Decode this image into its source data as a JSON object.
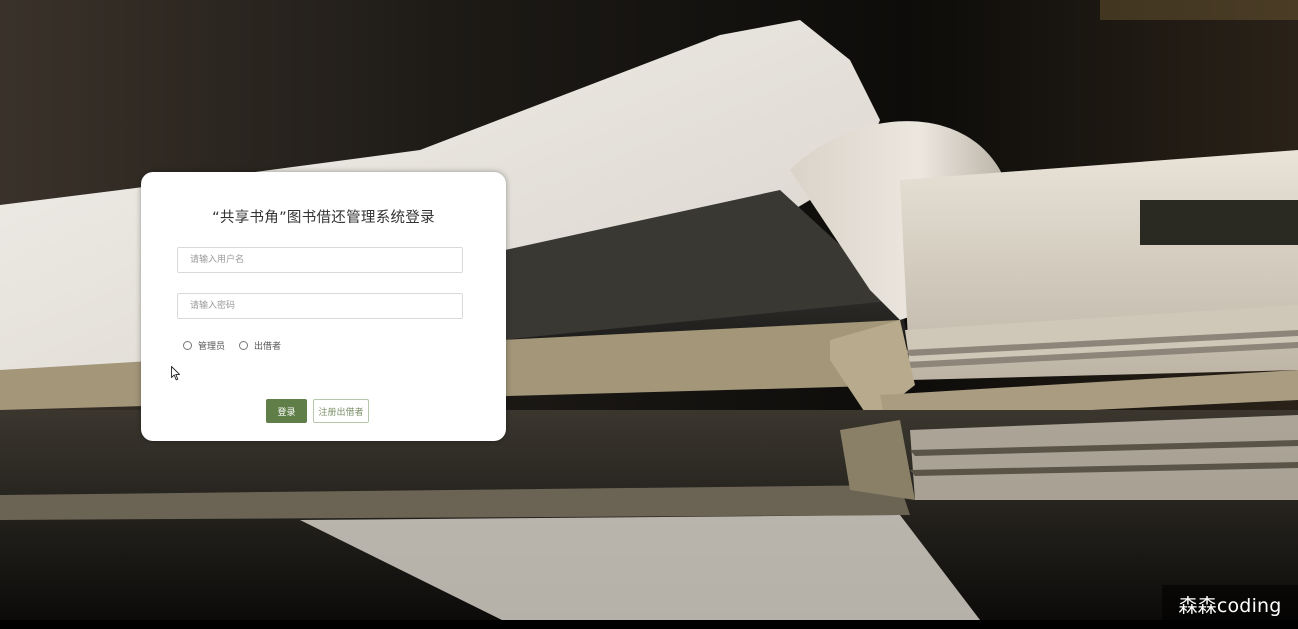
{
  "login": {
    "title": "“共享书角”图书借还管理系统登录",
    "username_placeholder": "请输入用户名",
    "password_placeholder": "请输入密码",
    "roles": [
      "管理员",
      "出借者"
    ],
    "login_button": "登录",
    "register_button": "注册出借者"
  },
  "watermark": "森森coding",
  "colors": {
    "accent": "#5f7e48",
    "register_text": "#7b8f68",
    "card_bg": "#ffffff"
  }
}
